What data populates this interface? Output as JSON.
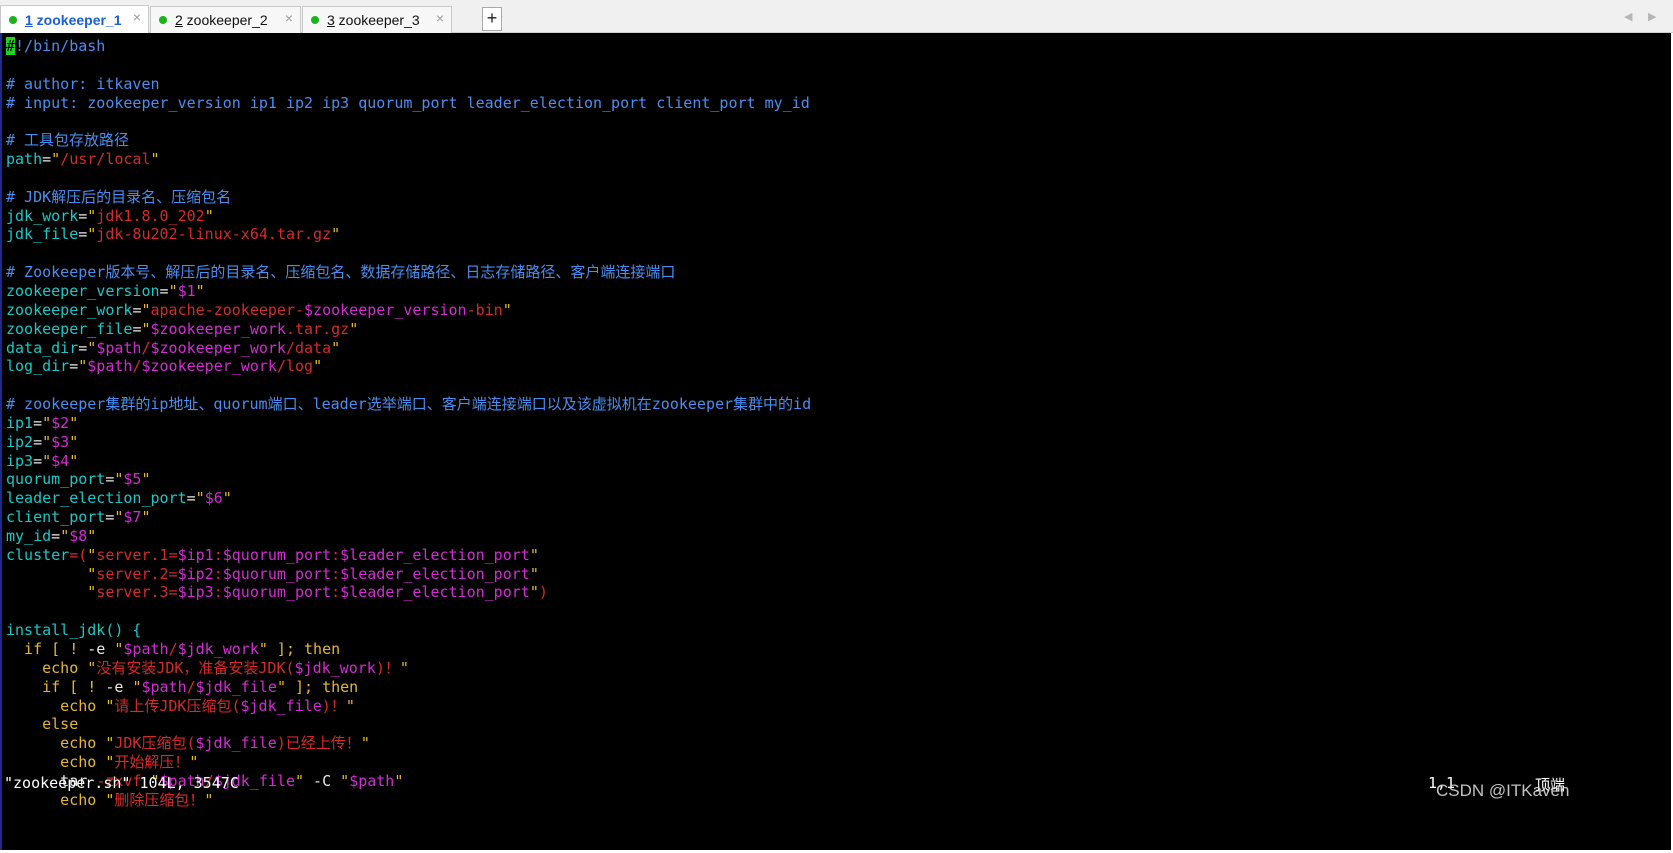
{
  "tabs": [
    {
      "num": "1",
      "name": " zookeeper_1",
      "active": true
    },
    {
      "num": "2",
      "name": " zookeeper_2",
      "active": false
    },
    {
      "num": "3",
      "name": " zookeeper_3",
      "active": false
    }
  ],
  "add_tab_label": "+",
  "close_glyph": "×",
  "nav": {
    "left": "◀",
    "right": "▶"
  },
  "colors": {
    "comment": "#4a8ef0",
    "variable": "#17c9c9",
    "string": "#d42b2b",
    "quote": "#e6b733",
    "substitution": "#d42bd4",
    "keyword": "#e6b733",
    "cursor": "#22d422",
    "status_dot": "#1db11d",
    "active_tab_text": "#1a5fd6"
  },
  "code_lines": [
    [
      {
        "t": "#",
        "c": "cursor"
      },
      {
        "t": "!/bin/bash",
        "c": "comment"
      }
    ],
    [],
    [
      {
        "t": "# author: itkaven",
        "c": "comment"
      }
    ],
    [
      {
        "t": "# input: zookeeper_version ip1 ip2 ip3 quorum_port leader_election_port client_port my_id",
        "c": "comment"
      }
    ],
    [],
    [
      {
        "t": "# 工具包存放路径",
        "c": "comment"
      }
    ],
    [
      {
        "t": "path",
        "c": "var"
      },
      {
        "t": "=",
        "c": "white"
      },
      {
        "t": "\"",
        "c": "dq"
      },
      {
        "t": "/usr/local",
        "c": "str"
      },
      {
        "t": "\"",
        "c": "dq"
      }
    ],
    [],
    [
      {
        "t": "# JDK解压后的目录名、压缩包名",
        "c": "comment"
      }
    ],
    [
      {
        "t": "jdk_work",
        "c": "var"
      },
      {
        "t": "=",
        "c": "white"
      },
      {
        "t": "\"",
        "c": "dq"
      },
      {
        "t": "jdk1.8.0_202",
        "c": "str"
      },
      {
        "t": "\"",
        "c": "dq"
      }
    ],
    [
      {
        "t": "jdk_file",
        "c": "var"
      },
      {
        "t": "=",
        "c": "white"
      },
      {
        "t": "\"",
        "c": "dq"
      },
      {
        "t": "jdk-8u202-linux-x64.tar.gz",
        "c": "str"
      },
      {
        "t": "\"",
        "c": "dq"
      }
    ],
    [],
    [
      {
        "t": "# Zookeeper版本号、解压后的目录名、压缩包名、数据存储路径、日志存储路径、客户端连接端口",
        "c": "comment"
      }
    ],
    [
      {
        "t": "zookeeper_version",
        "c": "var"
      },
      {
        "t": "=",
        "c": "white"
      },
      {
        "t": "\"",
        "c": "dq"
      },
      {
        "t": "$1",
        "c": "sub"
      },
      {
        "t": "\"",
        "c": "dq"
      }
    ],
    [
      {
        "t": "zookeeper_work",
        "c": "var"
      },
      {
        "t": "=",
        "c": "white"
      },
      {
        "t": "\"",
        "c": "dq"
      },
      {
        "t": "apache-zookeeper-",
        "c": "str"
      },
      {
        "t": "$zookeeper_version",
        "c": "sub"
      },
      {
        "t": "-bin",
        "c": "str"
      },
      {
        "t": "\"",
        "c": "dq"
      }
    ],
    [
      {
        "t": "zookeeper_file",
        "c": "var"
      },
      {
        "t": "=",
        "c": "white"
      },
      {
        "t": "\"",
        "c": "dq"
      },
      {
        "t": "$zookeeper_work",
        "c": "sub"
      },
      {
        "t": ".tar.gz",
        "c": "str"
      },
      {
        "t": "\"",
        "c": "dq"
      }
    ],
    [
      {
        "t": "data_dir",
        "c": "var"
      },
      {
        "t": "=",
        "c": "white"
      },
      {
        "t": "\"",
        "c": "dq"
      },
      {
        "t": "$path",
        "c": "sub"
      },
      {
        "t": "/",
        "c": "str"
      },
      {
        "t": "$zookeeper_work",
        "c": "sub"
      },
      {
        "t": "/data",
        "c": "str"
      },
      {
        "t": "\"",
        "c": "dq"
      }
    ],
    [
      {
        "t": "log_dir",
        "c": "var"
      },
      {
        "t": "=",
        "c": "white"
      },
      {
        "t": "\"",
        "c": "dq"
      },
      {
        "t": "$path",
        "c": "sub"
      },
      {
        "t": "/",
        "c": "str"
      },
      {
        "t": "$zookeeper_work",
        "c": "sub"
      },
      {
        "t": "/log",
        "c": "str"
      },
      {
        "t": "\"",
        "c": "dq"
      }
    ],
    [],
    [
      {
        "t": "# zookeeper集群的ip地址、quorum端口、leader选举端口、客户端连接端口以及该虚拟机在zookeeper集群中的id",
        "c": "comment"
      }
    ],
    [
      {
        "t": "ip1",
        "c": "var"
      },
      {
        "t": "=",
        "c": "white"
      },
      {
        "t": "\"",
        "c": "dq"
      },
      {
        "t": "$2",
        "c": "sub"
      },
      {
        "t": "\"",
        "c": "dq"
      }
    ],
    [
      {
        "t": "ip2",
        "c": "var"
      },
      {
        "t": "=",
        "c": "white"
      },
      {
        "t": "\"",
        "c": "dq"
      },
      {
        "t": "$3",
        "c": "sub"
      },
      {
        "t": "\"",
        "c": "dq"
      }
    ],
    [
      {
        "t": "ip3",
        "c": "var"
      },
      {
        "t": "=",
        "c": "white"
      },
      {
        "t": "\"",
        "c": "dq"
      },
      {
        "t": "$4",
        "c": "sub"
      },
      {
        "t": "\"",
        "c": "dq"
      }
    ],
    [
      {
        "t": "quorum_port",
        "c": "var"
      },
      {
        "t": "=",
        "c": "white"
      },
      {
        "t": "\"",
        "c": "dq"
      },
      {
        "t": "$5",
        "c": "sub"
      },
      {
        "t": "\"",
        "c": "dq"
      }
    ],
    [
      {
        "t": "leader_election_port",
        "c": "var"
      },
      {
        "t": "=",
        "c": "white"
      },
      {
        "t": "\"",
        "c": "dq"
      },
      {
        "t": "$6",
        "c": "sub"
      },
      {
        "t": "\"",
        "c": "dq"
      }
    ],
    [
      {
        "t": "client_port",
        "c": "var"
      },
      {
        "t": "=",
        "c": "white"
      },
      {
        "t": "\"",
        "c": "dq"
      },
      {
        "t": "$7",
        "c": "sub"
      },
      {
        "t": "\"",
        "c": "dq"
      }
    ],
    [
      {
        "t": "my_id",
        "c": "var"
      },
      {
        "t": "=",
        "c": "white"
      },
      {
        "t": "\"",
        "c": "dq"
      },
      {
        "t": "$8",
        "c": "sub"
      },
      {
        "t": "\"",
        "c": "dq"
      }
    ],
    [
      {
        "t": "cluster",
        "c": "var"
      },
      {
        "t": "=(",
        "c": "str"
      },
      {
        "t": "\"",
        "c": "dq"
      },
      {
        "t": "server.1=",
        "c": "str"
      },
      {
        "t": "$ip1",
        "c": "sub"
      },
      {
        "t": ":",
        "c": "str"
      },
      {
        "t": "$quorum_port",
        "c": "sub"
      },
      {
        "t": ":",
        "c": "str"
      },
      {
        "t": "$leader_election_port",
        "c": "sub"
      },
      {
        "t": "\"",
        "c": "dq"
      }
    ],
    [
      {
        "t": "         ",
        "c": "white"
      },
      {
        "t": "\"",
        "c": "dq"
      },
      {
        "t": "server.2=",
        "c": "str"
      },
      {
        "t": "$ip2",
        "c": "sub"
      },
      {
        "t": ":",
        "c": "str"
      },
      {
        "t": "$quorum_port",
        "c": "sub"
      },
      {
        "t": ":",
        "c": "str"
      },
      {
        "t": "$leader_election_port",
        "c": "sub"
      },
      {
        "t": "\"",
        "c": "dq"
      }
    ],
    [
      {
        "t": "         ",
        "c": "white"
      },
      {
        "t": "\"",
        "c": "dq"
      },
      {
        "t": "server.3=",
        "c": "str"
      },
      {
        "t": "$ip3",
        "c": "sub"
      },
      {
        "t": ":",
        "c": "str"
      },
      {
        "t": "$quorum_port",
        "c": "sub"
      },
      {
        "t": ":",
        "c": "str"
      },
      {
        "t": "$leader_election_port",
        "c": "sub"
      },
      {
        "t": "\"",
        "c": "dq"
      },
      {
        "t": ")",
        "c": "str"
      }
    ],
    [],
    [
      {
        "t": "install_jdk() {",
        "c": "var"
      }
    ],
    [
      {
        "t": "  if [ ! ",
        "c": "kw"
      },
      {
        "t": "-e",
        "c": "white"
      },
      {
        "t": " ",
        "c": "white"
      },
      {
        "t": "\"",
        "c": "dq"
      },
      {
        "t": "$path",
        "c": "sub"
      },
      {
        "t": "/",
        "c": "str"
      },
      {
        "t": "$jdk_work",
        "c": "sub"
      },
      {
        "t": "\"",
        "c": "dq"
      },
      {
        "t": " ]; then",
        "c": "kw"
      }
    ],
    [
      {
        "t": "    echo ",
        "c": "kw"
      },
      {
        "t": "\"",
        "c": "dq"
      },
      {
        "t": "没有安装JDK，准备安装JDK(",
        "c": "str"
      },
      {
        "t": "$jdk_work",
        "c": "sub"
      },
      {
        "t": ")！",
        "c": "str"
      },
      {
        "t": "\"",
        "c": "dq"
      }
    ],
    [
      {
        "t": "    if [ ! ",
        "c": "kw"
      },
      {
        "t": "-e",
        "c": "white"
      },
      {
        "t": " ",
        "c": "white"
      },
      {
        "t": "\"",
        "c": "dq"
      },
      {
        "t": "$path",
        "c": "sub"
      },
      {
        "t": "/",
        "c": "str"
      },
      {
        "t": "$jdk_file",
        "c": "sub"
      },
      {
        "t": "\"",
        "c": "dq"
      },
      {
        "t": " ]; then",
        "c": "kw"
      }
    ],
    [
      {
        "t": "      echo ",
        "c": "kw"
      },
      {
        "t": "\"",
        "c": "dq"
      },
      {
        "t": "请上传JDK压缩包(",
        "c": "str"
      },
      {
        "t": "$jdk_file",
        "c": "sub"
      },
      {
        "t": ")！",
        "c": "str"
      },
      {
        "t": "\"",
        "c": "dq"
      }
    ],
    [
      {
        "t": "    else",
        "c": "kw"
      }
    ],
    [
      {
        "t": "      echo ",
        "c": "kw"
      },
      {
        "t": "\"",
        "c": "dq"
      },
      {
        "t": "JDK压缩包(",
        "c": "str"
      },
      {
        "t": "$jdk_file",
        "c": "sub"
      },
      {
        "t": ")已经上传！",
        "c": "str"
      },
      {
        "t": "\"",
        "c": "dq"
      }
    ],
    [
      {
        "t": "      echo ",
        "c": "kw"
      },
      {
        "t": "\"",
        "c": "dq"
      },
      {
        "t": "开始解压！",
        "c": "str"
      },
      {
        "t": "\"",
        "c": "dq"
      }
    ],
    [
      {
        "t": "      tar ",
        "c": "white"
      },
      {
        "t": "-zxvf",
        "c": "str"
      },
      {
        "t": " ",
        "c": "white"
      },
      {
        "t": "\"",
        "c": "dq"
      },
      {
        "t": "$path",
        "c": "sub"
      },
      {
        "t": "/",
        "c": "str"
      },
      {
        "t": "$jdk_file",
        "c": "sub"
      },
      {
        "t": "\"",
        "c": "dq"
      },
      {
        "t": " -C ",
        "c": "white"
      },
      {
        "t": "\"",
        "c": "dq"
      },
      {
        "t": "$path",
        "c": "sub"
      },
      {
        "t": "\"",
        "c": "dq"
      }
    ],
    [
      {
        "t": "      echo ",
        "c": "kw"
      },
      {
        "t": "\"",
        "c": "dq"
      },
      {
        "t": "删除压缩包！",
        "c": "str"
      },
      {
        "t": "\"",
        "c": "dq"
      }
    ]
  ],
  "status": {
    "file_info": "\"zookeeper.sh\" 104L, 3547C",
    "cursor_pos": "1,1",
    "scroll_pos": "顶端"
  },
  "watermark": "CSDN @ITKaven"
}
